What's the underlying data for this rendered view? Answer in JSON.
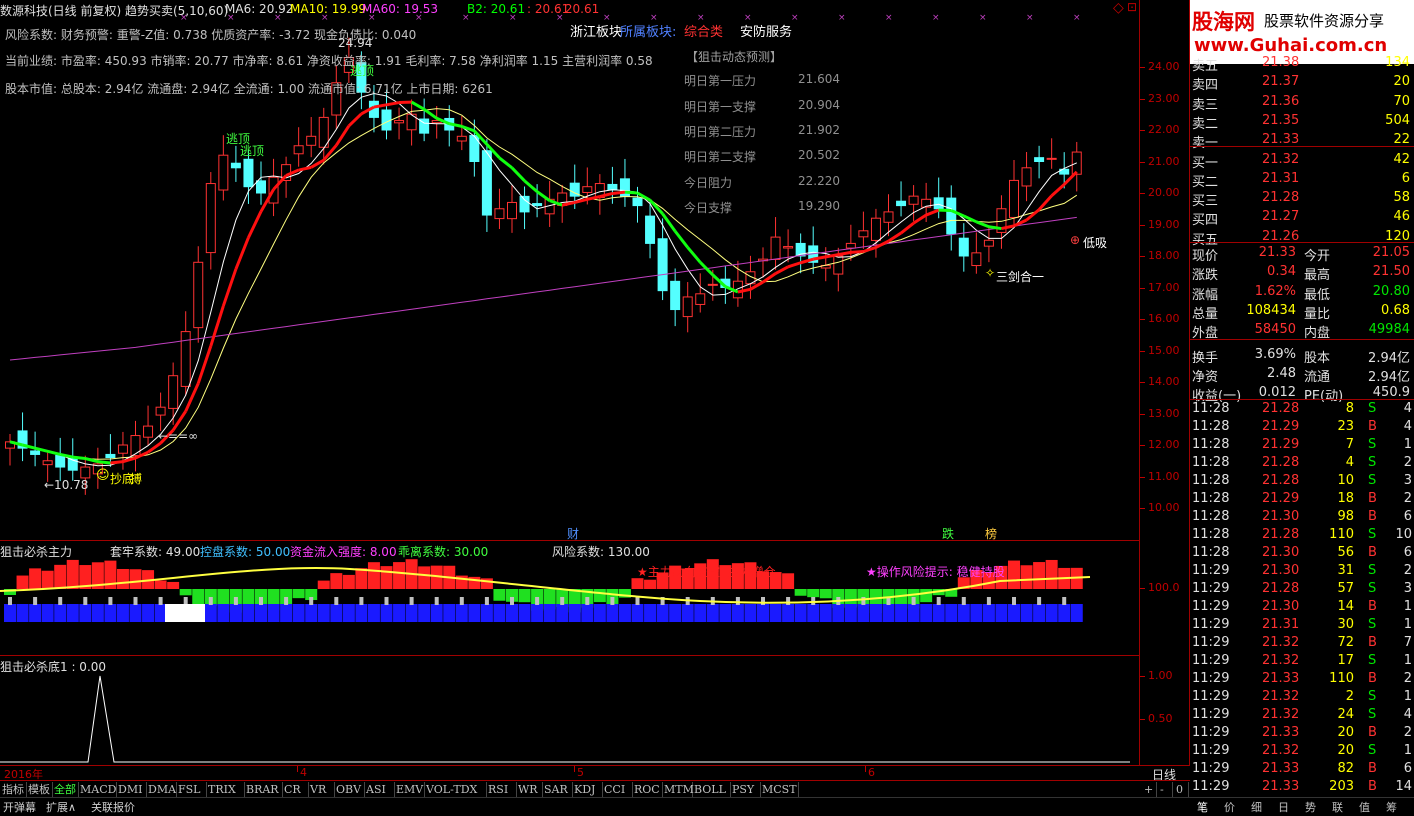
{
  "header": {
    "title": "数源科技(日线 前复权) 趋势买卖(5,10,60)",
    "ma6": "MA6: 20.92",
    "ma10": "MA10: 19.99",
    "ma60": "MA60: 19.53",
    "b2": "B2: 20.61",
    "v1": ": 20.61",
    "v2": ": 20.61",
    "sector1": "浙江板块",
    "sector2": "所属板块:",
    "sector3": "综合类",
    "sector4": "安防服务"
  },
  "info_lines": [
    "风险系数: 财务预警: 重警-Z值: 0.738 优质资产率: -3.72 现金负债比: 0.040",
    "当前业绩: 市盈率: 450.93 市销率: 20.77 市净率: 8.61 净资收益率: 1.91 毛利率: 7.58 净利润率 1.15 主营利润率 0.58",
    "股本市值: 总股本: 2.94亿 流通盘: 2.94亿 全流通: 1.00 流通市值: 6.71亿 上市日期: 6261"
  ],
  "forecast": {
    "title": "【狙击动态预测】",
    "rows": [
      {
        "label": "明日第一压力",
        "value": "21.604"
      },
      {
        "label": "明日第一支撑",
        "value": "20.904"
      },
      {
        "label": "明日第二压力",
        "value": "21.902"
      },
      {
        "label": "明日第二支撑",
        "value": "20.502"
      },
      {
        "label": "今日阻力",
        "value": "22.220"
      },
      {
        "label": "今日支撑",
        "value": "19.290"
      }
    ]
  },
  "annotations": {
    "escape1": "逃顶",
    "escape2": "逃顶",
    "escape3": "逃顶",
    "high_mark": "24.94",
    "low_mark": "←10.78",
    "ring_mark": "←==∞",
    "bottom_buy": "抄底",
    "vertical": "搏",
    "low_suck": "低吸",
    "sword": "三剑合一",
    "cai": "财",
    "die": "跌",
    "bang": "榜"
  },
  "price_ticks": [
    "24.00",
    "23.00",
    "22.00",
    "21.00",
    "20.00",
    "19.00",
    "18.00",
    "17.00",
    "16.00",
    "15.00",
    "14.00",
    "13.00",
    "12.00",
    "11.00",
    "10.00"
  ],
  "ind1": {
    "name": "狙击必杀主力",
    "p1": "套牢系数: 49.00",
    "p2": "控盘系数: 50.00",
    "p3": "资金流入强度: 8.00",
    "p4": "乖离系数: 30.00",
    "p5": "风险系数: 130.00",
    "monitor": "★主力动向监控: 主力增仓",
    "risk": "★操作风险提示: 稳健持股",
    "axis": "100.0"
  },
  "ind2": {
    "name": "狙击必杀底1 : 0.00",
    "axis1": "1.00",
    "axis2": "0.50"
  },
  "date_axis": {
    "labels": [
      "2016年",
      "4",
      "5",
      "6"
    ],
    "period": "日线"
  },
  "tabs": [
    "指标",
    "模板",
    "全部",
    "MACD",
    "DMI",
    "DMA",
    "FSL",
    "TRIX",
    "BRAR",
    "CR",
    "VR",
    "OBV",
    "ASI",
    "EMV",
    "VOL-TDX",
    "RSI",
    "WR",
    "SAR",
    "KDJ",
    "CCI",
    "ROC",
    "MTM",
    "BOLL",
    "PSY",
    "MCST"
  ],
  "tab_right": [
    "+",
    "-",
    "0"
  ],
  "bottom_tabs": [
    "开弹幕",
    "扩展∧",
    "关联报价"
  ],
  "panel_tabs": [
    "笔",
    "价",
    "细",
    "日",
    "势",
    "联",
    "值",
    "筹"
  ],
  "logo": {
    "main": "股海网",
    "sub": "股票软件资源分享",
    "url": "www.Guhai.com.cn"
  },
  "order_book": [
    {
      "label": "卖五",
      "price": "21.38",
      "vol": "134"
    },
    {
      "label": "卖四",
      "price": "21.37",
      "vol": "20"
    },
    {
      "label": "卖三",
      "price": "21.36",
      "vol": "70"
    },
    {
      "label": "卖二",
      "price": "21.35",
      "vol": "504"
    },
    {
      "label": "卖一",
      "price": "21.33",
      "vol": "22"
    },
    {
      "label": "买一",
      "price": "21.32",
      "vol": "42"
    },
    {
      "label": "买二",
      "price": "21.31",
      "vol": "6"
    },
    {
      "label": "买三",
      "price": "21.28",
      "vol": "58"
    },
    {
      "label": "买四",
      "price": "21.27",
      "vol": "46"
    },
    {
      "label": "买五",
      "price": "21.26",
      "vol": "120"
    }
  ],
  "quote": [
    {
      "l1": "现价",
      "v1": "21.33",
      "l2": "今开",
      "v2": "21.05"
    },
    {
      "l1": "涨跌",
      "v1": "0.34",
      "l2": "最高",
      "v2": "21.50"
    },
    {
      "l1": "涨幅",
      "v1": "1.62%",
      "l2": "最低",
      "v2": "20.80"
    },
    {
      "l1": "总量",
      "v1": "108434",
      "l2": "量比",
      "v2": "0.68"
    },
    {
      "l1": "外盘",
      "v1": "58450",
      "l2": "内盘",
      "v2": "49984"
    },
    {
      "l1": "换手",
      "v1": "3.69%",
      "l2": "股本",
      "v2": "2.94亿"
    },
    {
      "l1": "净资",
      "v1": "2.48",
      "l2": "流通",
      "v2": "2.94亿"
    },
    {
      "l1": "收益(一)",
      "v1": "0.012",
      "l2": "PE(动)",
      "v2": "450.9"
    }
  ],
  "ticks": [
    {
      "t": "11:28",
      "p": "21.28",
      "v": "8",
      "s": "S",
      "n": "4"
    },
    {
      "t": "11:28",
      "p": "21.29",
      "v": "23",
      "s": "B",
      "n": "4"
    },
    {
      "t": "11:28",
      "p": "21.29",
      "v": "7",
      "s": "S",
      "n": "1"
    },
    {
      "t": "11:28",
      "p": "21.28",
      "v": "4",
      "s": "S",
      "n": "2"
    },
    {
      "t": "11:28",
      "p": "21.28",
      "v": "10",
      "s": "S",
      "n": "3"
    },
    {
      "t": "11:28",
      "p": "21.29",
      "v": "18",
      "s": "B",
      "n": "2"
    },
    {
      "t": "11:28",
      "p": "21.30",
      "v": "98",
      "s": "B",
      "n": "6"
    },
    {
      "t": "11:28",
      "p": "21.28",
      "v": "110",
      "s": "S",
      "n": "10"
    },
    {
      "t": "11:28",
      "p": "21.30",
      "v": "56",
      "s": "B",
      "n": "6"
    },
    {
      "t": "11:29",
      "p": "21.30",
      "v": "31",
      "s": "S",
      "n": "2"
    },
    {
      "t": "11:29",
      "p": "21.28",
      "v": "57",
      "s": "S",
      "n": "3"
    },
    {
      "t": "11:29",
      "p": "21.30",
      "v": "14",
      "s": "B",
      "n": "1"
    },
    {
      "t": "11:29",
      "p": "21.31",
      "v": "30",
      "s": "S",
      "n": "1"
    },
    {
      "t": "11:29",
      "p": "21.32",
      "v": "72",
      "s": "B",
      "n": "7"
    },
    {
      "t": "11:29",
      "p": "21.32",
      "v": "17",
      "s": "S",
      "n": "1"
    },
    {
      "t": "11:29",
      "p": "21.33",
      "v": "110",
      "s": "B",
      "n": "2"
    },
    {
      "t": "11:29",
      "p": "21.32",
      "v": "2",
      "s": "S",
      "n": "1"
    },
    {
      "t": "11:29",
      "p": "21.32",
      "v": "24",
      "s": "S",
      "n": "4"
    },
    {
      "t": "11:29",
      "p": "21.33",
      "v": "20",
      "s": "B",
      "n": "2"
    },
    {
      "t": "11:29",
      "p": "21.32",
      "v": "20",
      "s": "S",
      "n": "1"
    },
    {
      "t": "11:29",
      "p": "21.33",
      "v": "82",
      "s": "B",
      "n": "6"
    },
    {
      "t": "11:29",
      "p": "21.33",
      "v": "203",
      "s": "B",
      "n": "14"
    }
  ],
  "colors": {
    "up": "#ff3232",
    "down": "#54ffff",
    "ma_green": "#00ff00",
    "ma_red": "#ff0000",
    "ma60": "#c040c0",
    "border": "#a00000"
  }
}
